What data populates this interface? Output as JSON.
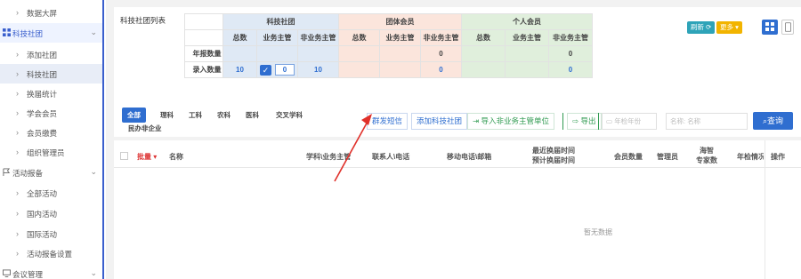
{
  "sidebar": {
    "items": [
      {
        "label": "数据大屏",
        "type": "sub"
      },
      {
        "label": "科技社团",
        "type": "group"
      },
      {
        "label": "添加社团",
        "type": "sub"
      },
      {
        "label": "科技社团",
        "type": "sub"
      },
      {
        "label": "换届统计",
        "type": "sub"
      },
      {
        "label": "学会会员",
        "type": "sub"
      },
      {
        "label": "会员缴费",
        "type": "sub"
      },
      {
        "label": "组织管理员",
        "type": "sub"
      },
      {
        "label": "活动报备",
        "type": "group"
      },
      {
        "label": "全部活动",
        "type": "sub"
      },
      {
        "label": "国内活动",
        "type": "sub"
      },
      {
        "label": "国际活动",
        "type": "sub"
      },
      {
        "label": "活动报备设置",
        "type": "sub"
      },
      {
        "label": "会议管理",
        "type": "group"
      }
    ]
  },
  "stats": {
    "title": "科技社团列表",
    "groups": [
      "科技社团",
      "团体会员",
      "个人会员"
    ],
    "columns": [
      "总数",
      "业务主管",
      "非业务主管",
      "总数",
      "业务主管",
      "非业务主管",
      "总数",
      "业务主管",
      "非业务主管"
    ],
    "rows": [
      {
        "label": "年报数量",
        "values": [
          "",
          "",
          "",
          "",
          "",
          "0",
          "",
          "",
          "0"
        ]
      },
      {
        "label": "录入数量",
        "values": [
          "10",
          "0",
          "10",
          "",
          "",
          "0",
          "",
          "",
          "0"
        ]
      }
    ]
  },
  "toolbar": {
    "refresh_label": "刷新 ⟳",
    "more_label": "更多 ▾",
    "colors": {
      "primary": "#2f6ed0",
      "teal": "#2ea3b8",
      "amber": "#f2b400",
      "green": "#2e9a4f"
    }
  },
  "filters": [
    "全部",
    "理科",
    "工科",
    "农科",
    "医科",
    "交叉学科",
    "民办非企业"
  ],
  "actions": {
    "send_sms": "群发短信",
    "add_society": "添加科技社团",
    "import_units": "导入非业务主管单位",
    "export": "导出",
    "year_placeholder": "年检年份",
    "name_placeholder": "名称",
    "name_prefix": "名称:",
    "search_label": "查询"
  },
  "results": {
    "batch_label": "批量",
    "headers": {
      "name": "名称",
      "subject_dept": "学科\\业务主管",
      "contact_phone": "联系人\\电话",
      "mobile_email": "移动电话\\邮箱",
      "recent_renewal": "最近换届时间",
      "planned_renewal": "预计换届时间",
      "members": "会员数量",
      "admin": "管理员",
      "overseas": "海智",
      "experts": "专家数",
      "annual_check": "年检情况",
      "actions": "操作"
    },
    "empty": "暂无数据"
  }
}
